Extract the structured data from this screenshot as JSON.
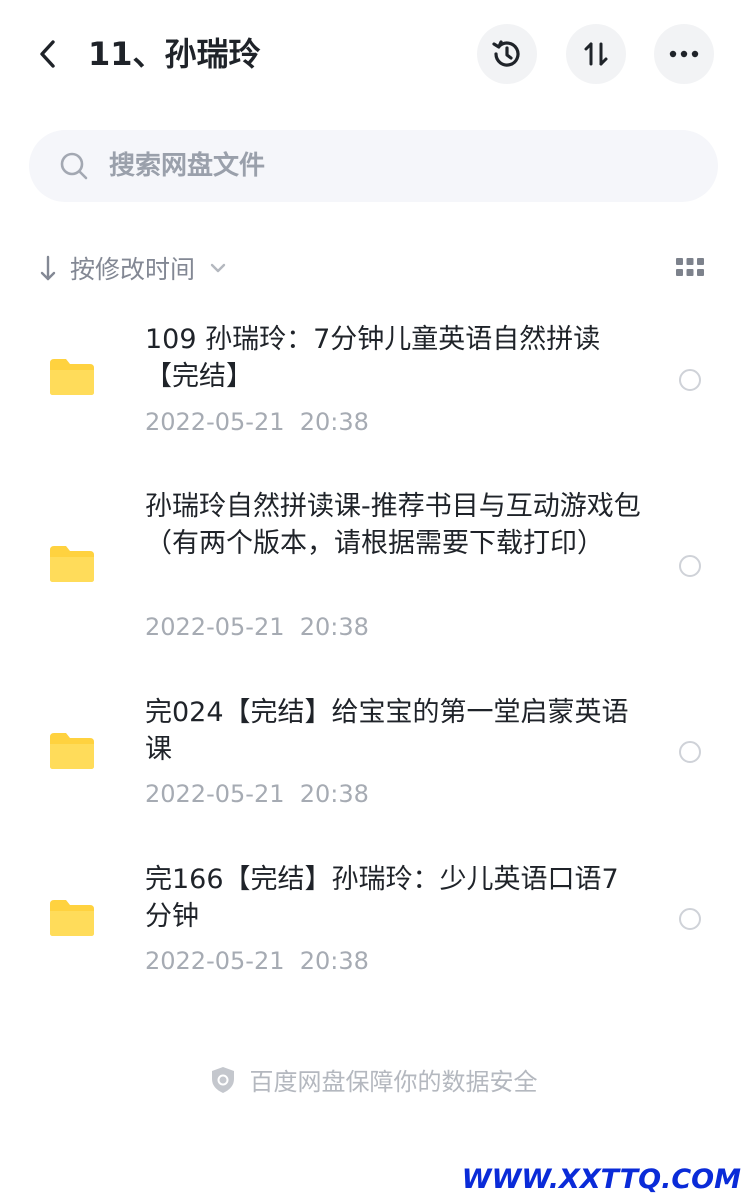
{
  "header": {
    "title": "11、孙瑞玲"
  },
  "search": {
    "placeholder": "搜索网盘文件"
  },
  "sort": {
    "label": "按修改时间"
  },
  "files": [
    {
      "name": "109 孙瑞玲：7分钟儿童英语自然拼读【完结】",
      "date": "2022-05-21  20:38"
    },
    {
      "name": "孙瑞玲自然拼读课-推荐书目与互动游戏包（有两个版本，请根据需要下载打印）",
      "date": "2022-05-21  20:38"
    },
    {
      "name": "完024【完结】给宝宝的第一堂启蒙英语课",
      "date": "2022-05-21  20:38"
    },
    {
      "name": "完166【完结】孙瑞玲：少儿英语口语7分钟",
      "date": "2022-05-21  20:38"
    }
  ],
  "footer": {
    "text": "百度网盘保障你的数据安全"
  },
  "watermark": "WWW.XXTTQ.COM",
  "colors": {
    "folder": "#ffd23f",
    "text_primary": "#1f2329",
    "text_secondary": "#a6abb3",
    "watermark": "#0a2bd8"
  },
  "icons": {
    "back": "chevron-left-icon",
    "history": "history-icon",
    "sort": "sort-swap-icon",
    "more": "more-icon",
    "search": "search-icon",
    "grid": "grid-view-icon",
    "folder": "folder-icon",
    "shield": "shield-icon"
  }
}
